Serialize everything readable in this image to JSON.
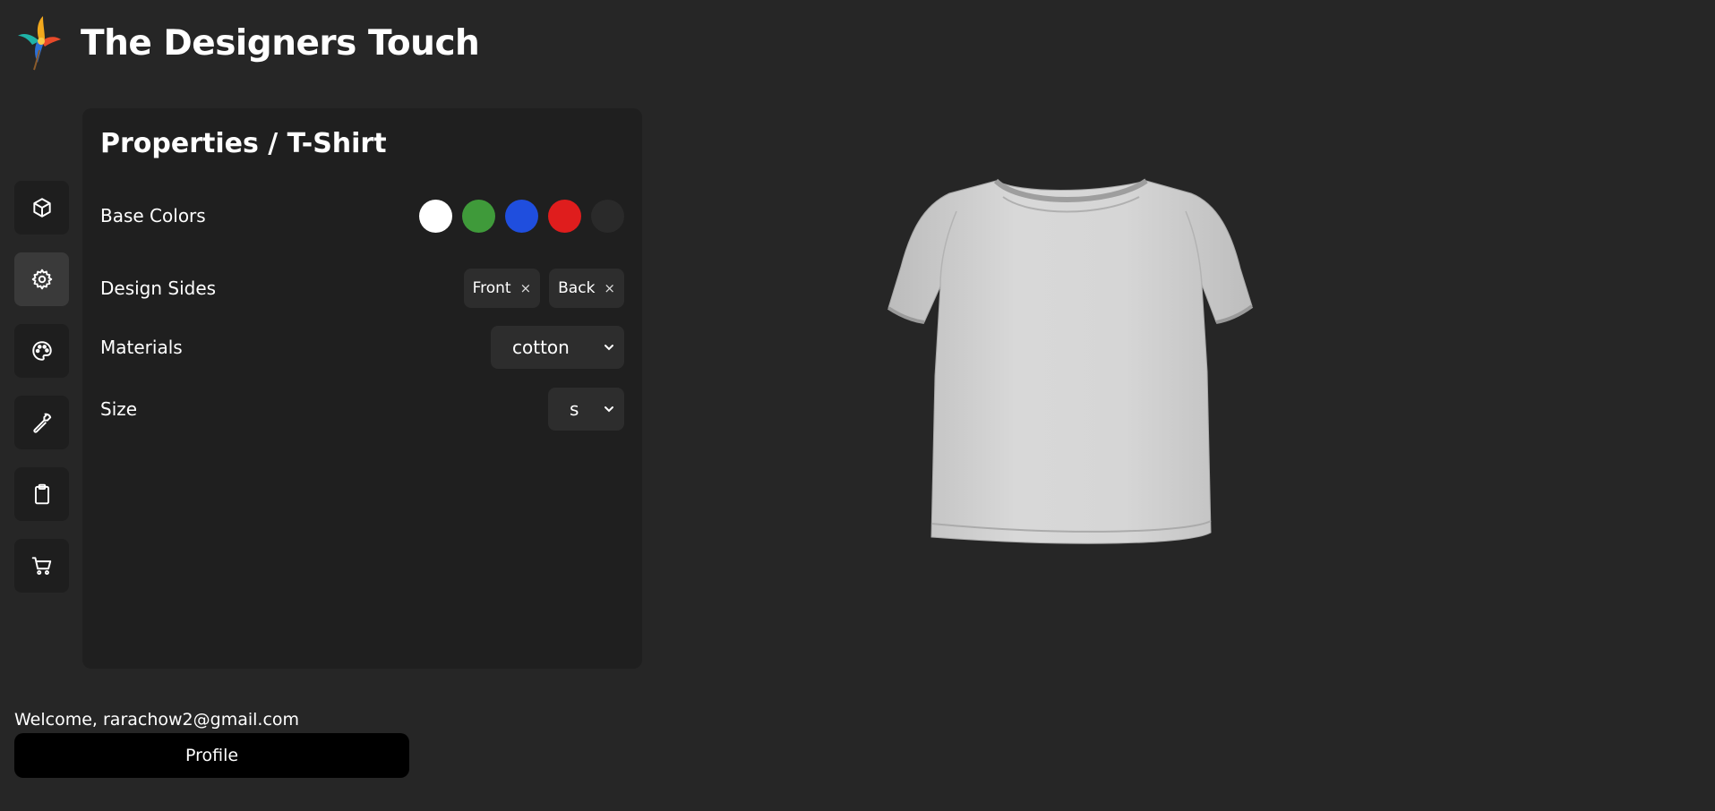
{
  "app": {
    "title": "The Designers Touch"
  },
  "toolbar": {
    "items": [
      {
        "name": "model",
        "icon": "box-icon",
        "active": false
      },
      {
        "name": "properties",
        "icon": "gear-icon",
        "active": true
      },
      {
        "name": "palette",
        "icon": "palette-icon",
        "active": false
      },
      {
        "name": "tools",
        "icon": "wrench-icon",
        "active": false
      },
      {
        "name": "clipboard",
        "icon": "clipboard-icon",
        "active": false
      },
      {
        "name": "cart",
        "icon": "cart-icon",
        "active": false
      }
    ]
  },
  "panel": {
    "title": "Properties / T-Shirt",
    "base_colors": {
      "label": "Base Colors",
      "swatches": [
        "#ffffff",
        "#3f9a3a",
        "#1f4ede",
        "#df1d1d",
        "#2a2a2a"
      ]
    },
    "design_sides": {
      "label": "Design Sides",
      "chips": [
        {
          "label": "Front",
          "remove": "×"
        },
        {
          "label": "Back",
          "remove": "×"
        }
      ]
    },
    "materials": {
      "label": "Materials",
      "value": "cotton"
    },
    "size": {
      "label": "Size",
      "value": "s"
    }
  },
  "footer": {
    "welcome": "Welcome, rarachow2@gmail.com",
    "profile_label": "Profile"
  }
}
